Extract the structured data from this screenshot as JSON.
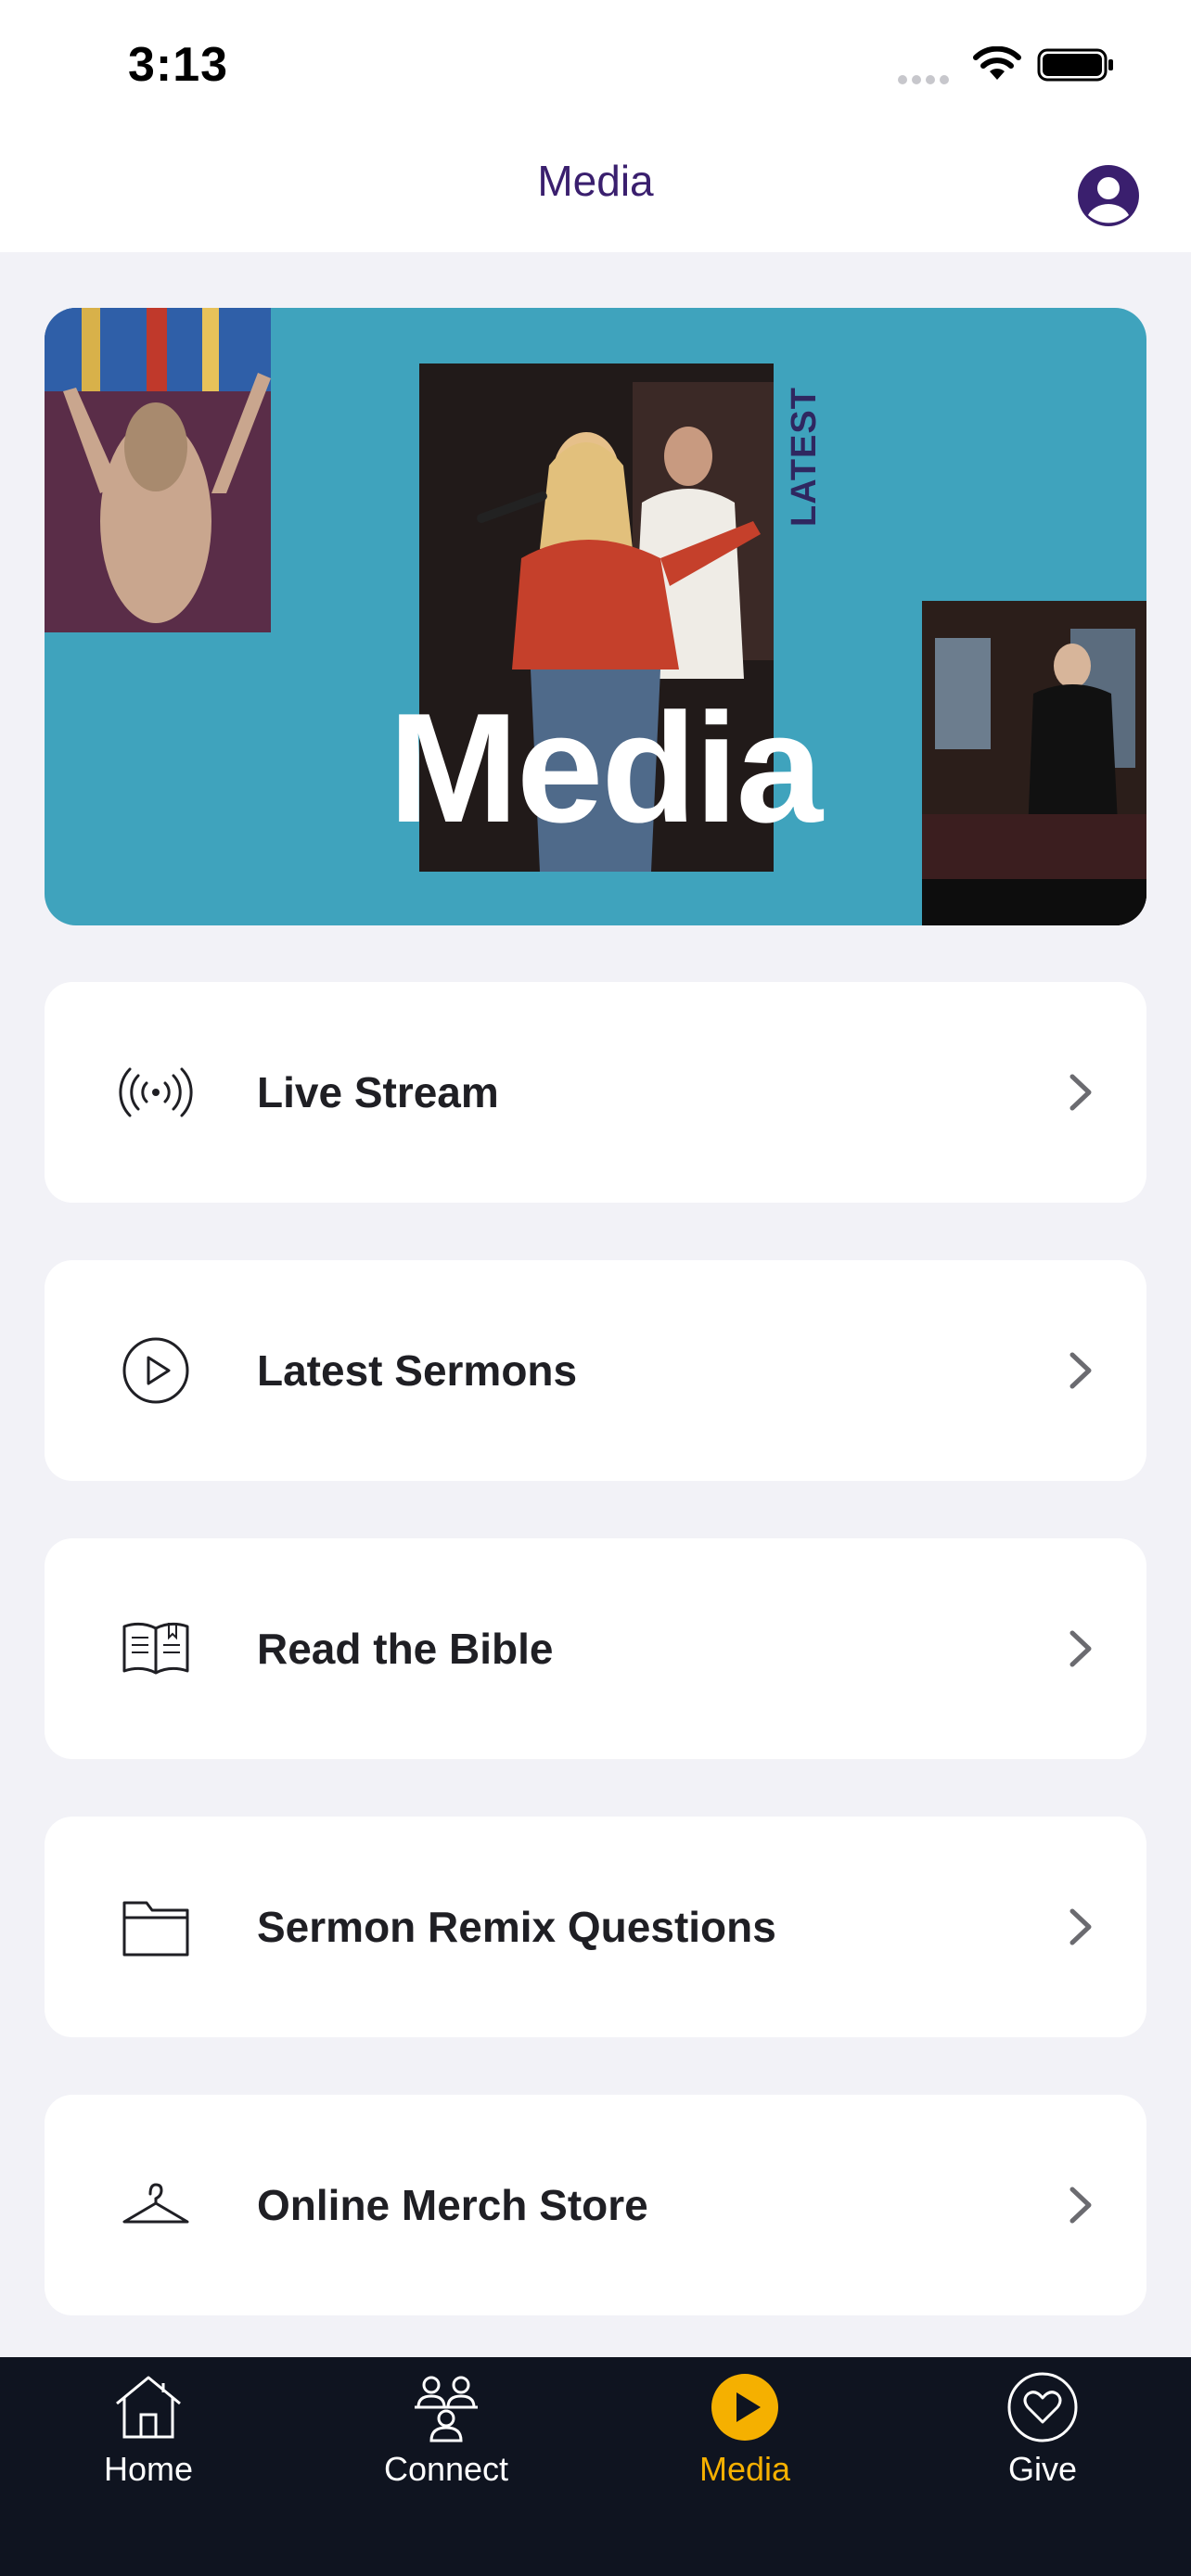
{
  "status_bar": {
    "time": "3:13"
  },
  "header": {
    "title": "Media"
  },
  "banner": {
    "side_text": "LATEST",
    "title": "Media"
  },
  "menu": [
    {
      "label": "Live Stream",
      "icon": "broadcast-icon"
    },
    {
      "label": "Latest Sermons",
      "icon": "play-circle-icon"
    },
    {
      "label": "Read the Bible",
      "icon": "book-icon"
    },
    {
      "label": "Sermon Remix Questions",
      "icon": "folder-icon"
    },
    {
      "label": "Online Merch Store",
      "icon": "hanger-icon"
    }
  ],
  "tabs": [
    {
      "label": "Home",
      "icon": "home-icon"
    },
    {
      "label": "Connect",
      "icon": "people-icon"
    },
    {
      "label": "Media",
      "icon": "play-icon",
      "active": true
    },
    {
      "label": "Give",
      "icon": "heart-icon"
    }
  ],
  "colors": {
    "accent": "#f5b000",
    "header_title": "#3a1f6e",
    "banner_bg": "#3fa3bd",
    "tabbar_bg": "#0f1420"
  }
}
